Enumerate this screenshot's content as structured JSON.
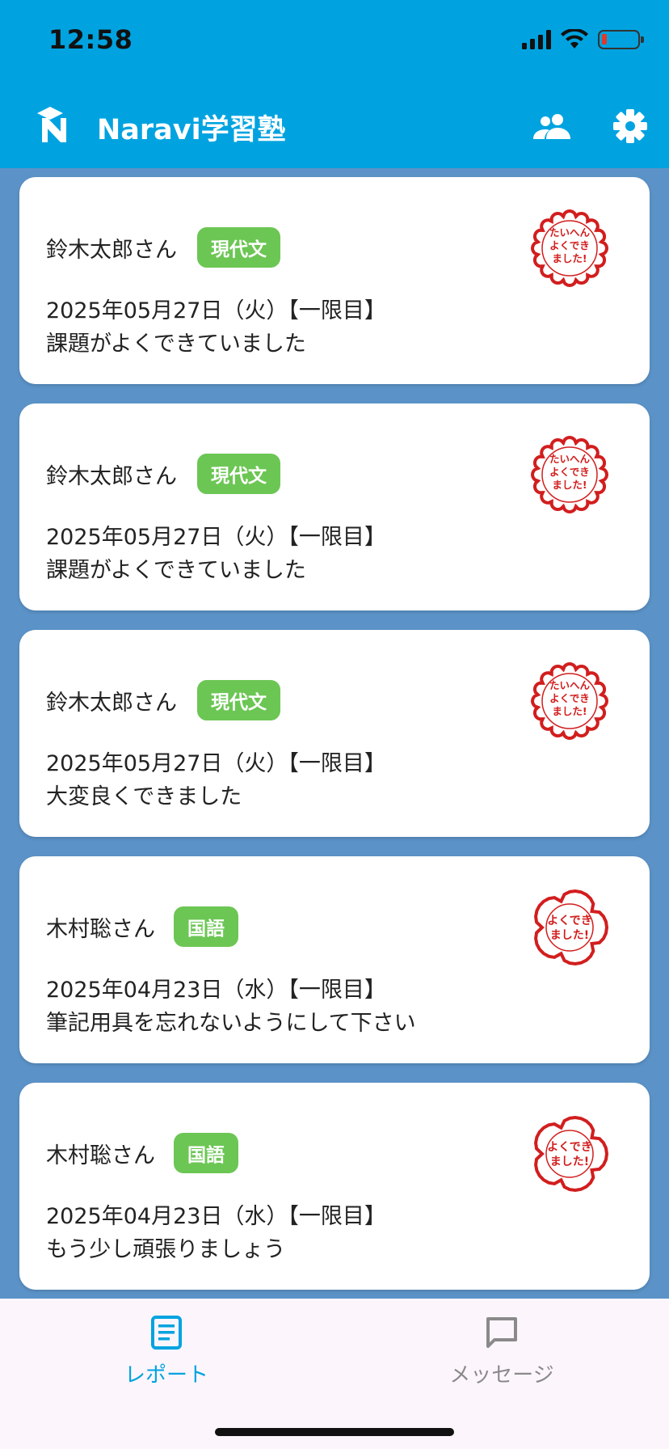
{
  "status_bar": {
    "time": "12:58"
  },
  "header": {
    "title": "Naravi学習塾"
  },
  "reports": [
    {
      "student": "鈴木太郎さん",
      "subject": "現代文",
      "date": "2025年05月27日（火）【一限目】",
      "comment": "課題がよくできていました",
      "stamp": [
        "たいへん",
        "よくでき",
        "ました!"
      ]
    },
    {
      "student": "鈴木太郎さん",
      "subject": "現代文",
      "date": "2025年05月27日（火）【一限目】",
      "comment": "課題がよくできていました",
      "stamp": [
        "たいへん",
        "よくでき",
        "ました!"
      ]
    },
    {
      "student": "鈴木太郎さん",
      "subject": "現代文",
      "date": "2025年05月27日（火）【一限目】",
      "comment": "大変良くできました",
      "stamp": [
        "たいへん",
        "よくでき",
        "ました!"
      ]
    },
    {
      "student": "木村聡さん",
      "subject": "国語",
      "date": "2025年04月23日（水）【一限目】",
      "comment": "筆記用具を忘れないようにして下さい",
      "stamp": [
        "よくでき",
        "ました!"
      ]
    },
    {
      "student": "木村聡さん",
      "subject": "国語",
      "date": "2025年04月23日（水）【一限目】",
      "comment": "もう少し頑張りましょう",
      "stamp": [
        "よくでき",
        "ました!"
      ]
    }
  ],
  "tabs": [
    {
      "label": "レポート",
      "icon": "report-icon",
      "active": true
    },
    {
      "label": "メッセージ",
      "icon": "message-icon",
      "active": false
    }
  ],
  "colors": {
    "header": "#00a3e0",
    "background": "#5b93c8",
    "badge": "#6cc654",
    "stamp": "#d21e1e",
    "tab_active": "#00a3e0",
    "tab_inactive": "#8a8a8a"
  }
}
